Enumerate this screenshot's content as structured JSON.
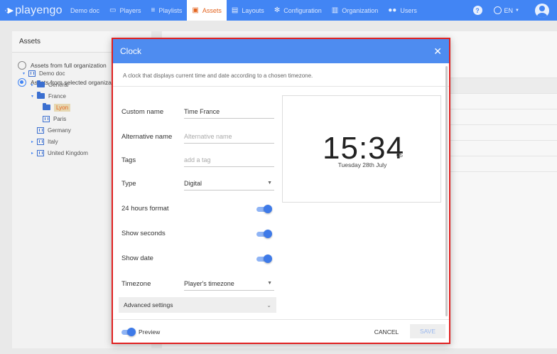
{
  "topbar": {
    "logo": "playengo",
    "items": [
      {
        "label": "Demo doc",
        "icon": ""
      },
      {
        "label": "Players",
        "icon": "monitor-icon"
      },
      {
        "label": "Playlists",
        "icon": "playlist-icon"
      },
      {
        "label": "Assets",
        "icon": "assets-icon",
        "active": true
      },
      {
        "label": "Layouts",
        "icon": "layouts-icon"
      },
      {
        "label": "Configuration",
        "icon": "gear-icon"
      },
      {
        "label": "Organization",
        "icon": "organization-icon"
      },
      {
        "label": "Users",
        "icon": "users-icon"
      }
    ],
    "help_symbol": "?",
    "language": "EN",
    "accent_color": "#4285f4",
    "active_color": "#e3641f"
  },
  "assets_panel": {
    "title": "Assets",
    "radio_full": "Assets from full organization",
    "radio_selected": "Assets from selected organization",
    "tree": [
      {
        "label": "Demo doc",
        "icon": "organization-icon",
        "caret": "▾"
      },
      {
        "label": "General",
        "icon": "folder-icon",
        "caret": "▸"
      },
      {
        "label": "France",
        "icon": "folder-icon",
        "caret": "▾"
      },
      {
        "label": "Lyon",
        "icon": "folder-icon",
        "caret": "",
        "selected": true
      },
      {
        "label": "Paris",
        "icon": "organization-icon",
        "caret": ""
      },
      {
        "label": "Germany",
        "icon": "organization-icon",
        "caret": ""
      },
      {
        "label": "Italy",
        "icon": "organization-icon",
        "caret": "▸"
      },
      {
        "label": "United Kingdom",
        "icon": "organization-icon",
        "caret": "▸"
      }
    ]
  },
  "modal": {
    "title": "Clock",
    "close_symbol": "✕",
    "description": "A clock that displays current time and date according to a chosen timezone.",
    "fields": {
      "custom_name_label": "Custom name",
      "custom_name_value": "Time France",
      "alt_name_label": "Alternative name",
      "alt_name_placeholder": "Alternative name",
      "tags_label": "Tags",
      "tags_placeholder": "add a tag",
      "type_label": "Type",
      "type_value": "Digital",
      "hours24_label": "24 hours format",
      "hours24_on": true,
      "seconds_label": "Show seconds",
      "seconds_on": true,
      "date_label": "Show date",
      "date_on": true,
      "timezone_label": "Timezone",
      "timezone_value": "Player's timezone"
    },
    "advanced_label": "Advanced settings",
    "preview_clock": {
      "time": "15:34",
      "seconds": "05",
      "date": "Tuesday 28th July"
    },
    "footer": {
      "preview_label": "Preview",
      "preview_on": true,
      "cancel": "CANCEL",
      "save": "SAVE"
    },
    "highlight_color": "#e02020"
  }
}
